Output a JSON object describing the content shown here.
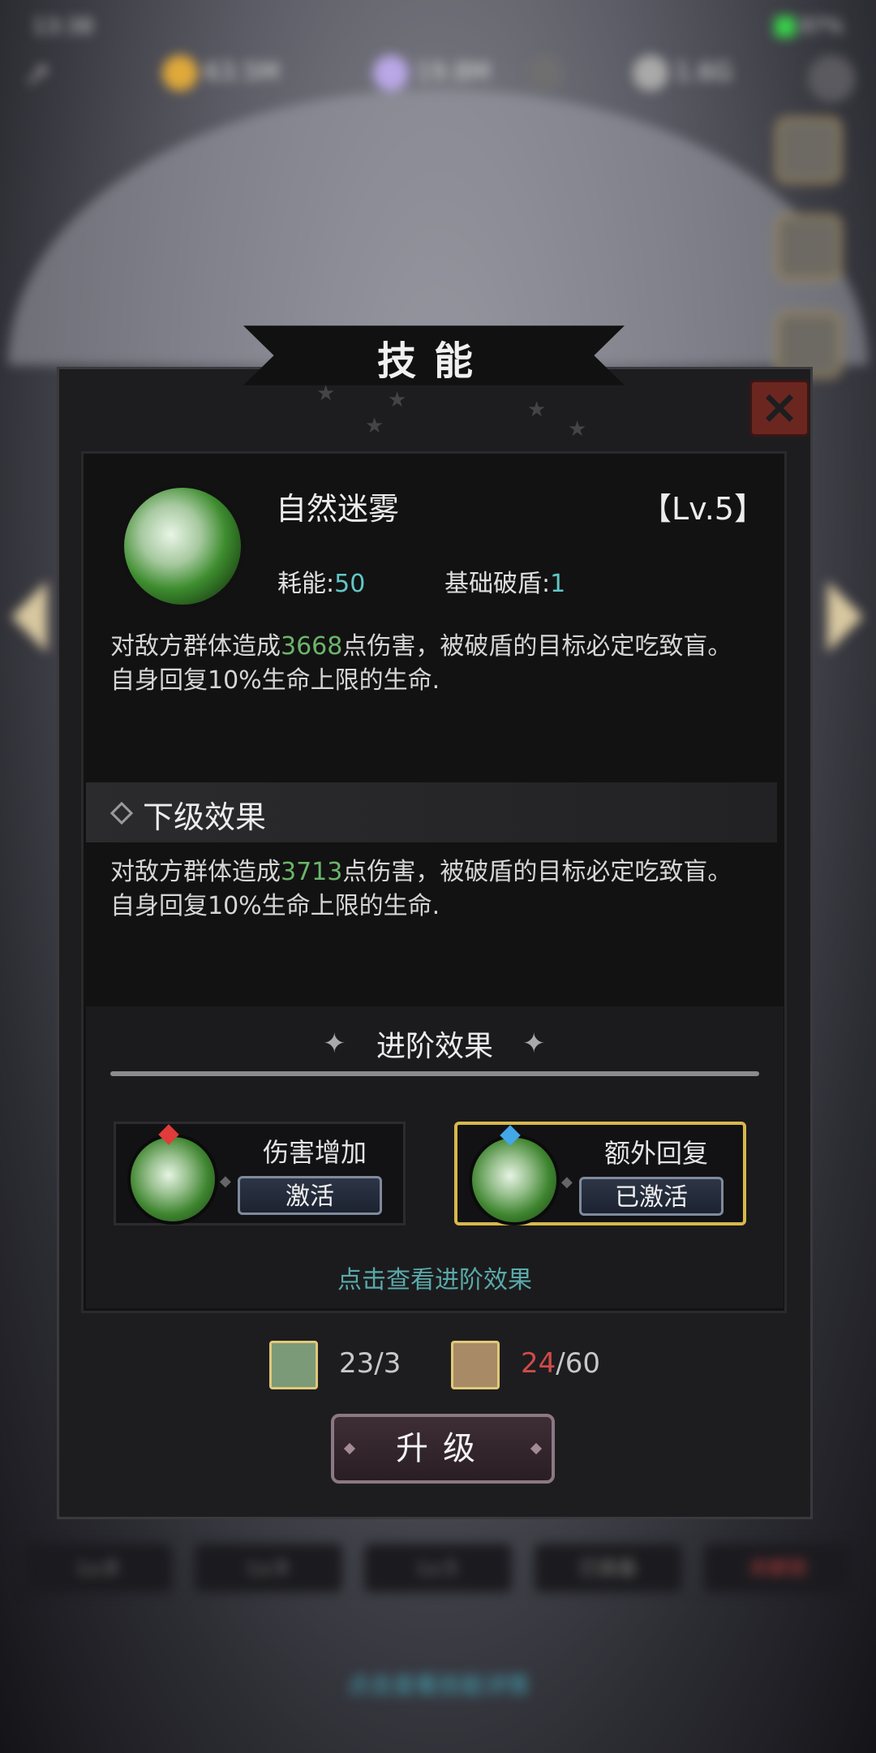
{
  "statusbar": {
    "time": "13:38",
    "battery": "87%"
  },
  "resources": [
    {
      "name": "gold",
      "value": "63.5M",
      "color": "#e0a93a"
    },
    {
      "name": "diamond",
      "value": "19.8M",
      "color": "#b9a7e6"
    },
    {
      "name": "gem",
      "value": "",
      "color": "#6f6f6f"
    },
    {
      "name": "feather",
      "value": "1.6G",
      "color": "#a9a9a9"
    }
  ],
  "dialog": {
    "title": "技能",
    "skill": {
      "name": "自然迷雾",
      "level": "【Lv.5】",
      "cost_label": "耗能:",
      "cost_value": "50",
      "shield_label": "基础破盾:",
      "shield_value": "1",
      "desc_prefix": "对敌方群体造成",
      "desc_damage": "3668",
      "desc_suffix": "点伤害，被破盾的目标必定吃致盲。自身回复10%生命上限的生命."
    },
    "next_level": {
      "title": "下级效果",
      "desc_prefix": "对敌方群体造成",
      "desc_damage": "3713",
      "desc_suffix": "点伤害，被破盾的目标必定吃致盲。自身回复10%生命上限的生命."
    },
    "advanced": {
      "title": "进阶效果",
      "cards": [
        {
          "name": "伤害增加",
          "button": "激活",
          "gem_color": "#e23b3b"
        },
        {
          "name": "额外回复",
          "button": "已激活",
          "gem_color": "#43a7e8"
        }
      ],
      "hint": "点击查看进阶效果"
    },
    "costs": [
      {
        "have": "23",
        "sep": "/",
        "need": "3"
      },
      {
        "have": "24",
        "sep": "/",
        "need": "60"
      }
    ],
    "upgrade_label": "升级"
  },
  "background_tabs": [
    "Lv.8",
    "Lv.9",
    "Lv.5",
    "已装备",
    "未解锁"
  ],
  "background_hint": "点击查看技能详情"
}
